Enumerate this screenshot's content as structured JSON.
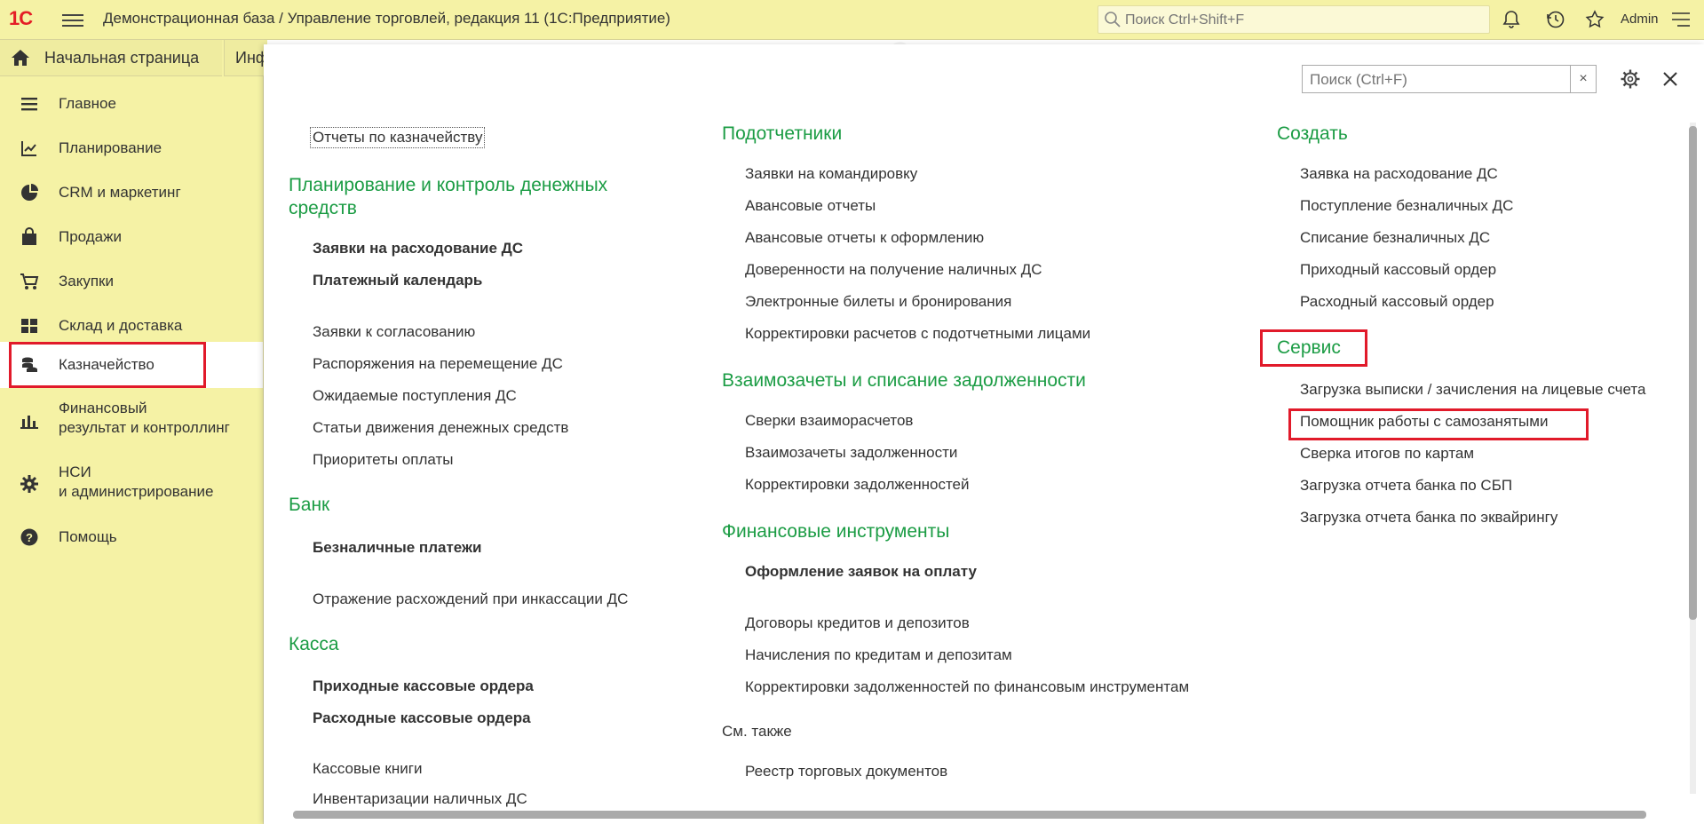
{
  "app": {
    "logo": "1С",
    "title": "Демонстрационная база / Управление торговлей, редакция 11  (1С:Предприятие)",
    "search_placeholder": "Поиск Ctrl+Shift+F",
    "user": "Admin"
  },
  "tabs": {
    "home": "Начальная страница",
    "info": "Инф"
  },
  "sidebar": {
    "items": [
      {
        "label": "Главное",
        "icon": "menu-icon"
      },
      {
        "label": "Планирование",
        "icon": "planning-icon"
      },
      {
        "label": "CRM и маркетинг",
        "icon": "pie-chart-icon"
      },
      {
        "label": "Продажи",
        "icon": "shopping-bag-icon"
      },
      {
        "label": "Закупки",
        "icon": "cart-icon"
      },
      {
        "label": "Склад и доставка",
        "icon": "warehouse-icon"
      },
      {
        "label": "Казначейство",
        "icon": "coins-icon"
      },
      {
        "label": "Финансовый\nрезультат и контроллинг",
        "icon": "bar-chart-icon"
      },
      {
        "label": "НСИ\nи администрирование",
        "icon": "gear-icon"
      },
      {
        "label": "Помощь",
        "icon": "help-icon"
      }
    ],
    "active": "Казначейство"
  },
  "panel": {
    "search_placeholder": "Поиск (Ctrl+F)",
    "clear_label": "×",
    "col1": {
      "top_link": "Отчеты по казначейству",
      "groups": [
        {
          "title": "Планирование и контроль денежных средств",
          "bold": [
            "Заявки на расходование ДС",
            "Платежный календарь"
          ],
          "items": [
            "Заявки к согласованию",
            "Распоряжения на перемещение ДС",
            "Ожидаемые поступления ДС",
            "Статьи движения денежных средств",
            "Приоритеты оплаты"
          ]
        },
        {
          "title": "Банк",
          "bold": [
            "Безналичные платежи"
          ],
          "items": [
            "Отражение расхождений при инкассации ДС"
          ]
        },
        {
          "title": "Касса",
          "bold": [
            "Приходные кассовые ордера",
            "Расходные кассовые ордера"
          ],
          "items": [
            "Кассовые книги",
            "Инвентаризации наличных ДС"
          ]
        }
      ]
    },
    "col2": {
      "groups": [
        {
          "title": "Подотчетники",
          "items": [
            "Заявки на командировку",
            "Авансовые отчеты",
            "Авансовые отчеты к оформлению",
            "Доверенности на получение наличных ДС",
            "Электронные билеты и бронирования",
            "Корректировки расчетов с подотчетными лицами"
          ]
        },
        {
          "title": "Взаимозачеты и списание задолженности",
          "items": [
            "Сверки взаиморасчетов",
            "Взаимозачеты задолженности",
            "Корректировки задолженностей"
          ]
        },
        {
          "title": "Финансовые инструменты",
          "bold": [
            "Оформление заявок на оплату"
          ],
          "items": [
            "Договоры кредитов и депозитов",
            "Начисления по кредитам и депозитам",
            "Корректировки задолженностей по финансовым инструментам"
          ]
        }
      ],
      "see_also": "См. также",
      "see_also_items": [
        "Реестр торговых документов"
      ]
    },
    "col3": {
      "groups": [
        {
          "title": "Создать",
          "items": [
            "Заявка на расходование ДС",
            "Поступление безналичных ДС",
            "Списание безналичных ДС",
            "Приходный кассовый ордер",
            "Расходный кассовый ордер"
          ]
        },
        {
          "title": "Сервис",
          "items": [
            "Загрузка выписки / зачисления на лицевые счета",
            "Помощник работы с самозанятыми",
            "Сверка итогов по картам",
            "Загрузка отчета банка по СБП",
            "Загрузка отчета банка по эквайрингу"
          ]
        }
      ]
    }
  },
  "colors": {
    "sidebar_bg": "#f5f2a5",
    "group_title": "#1b9c44",
    "highlight": "#e11a2a"
  }
}
